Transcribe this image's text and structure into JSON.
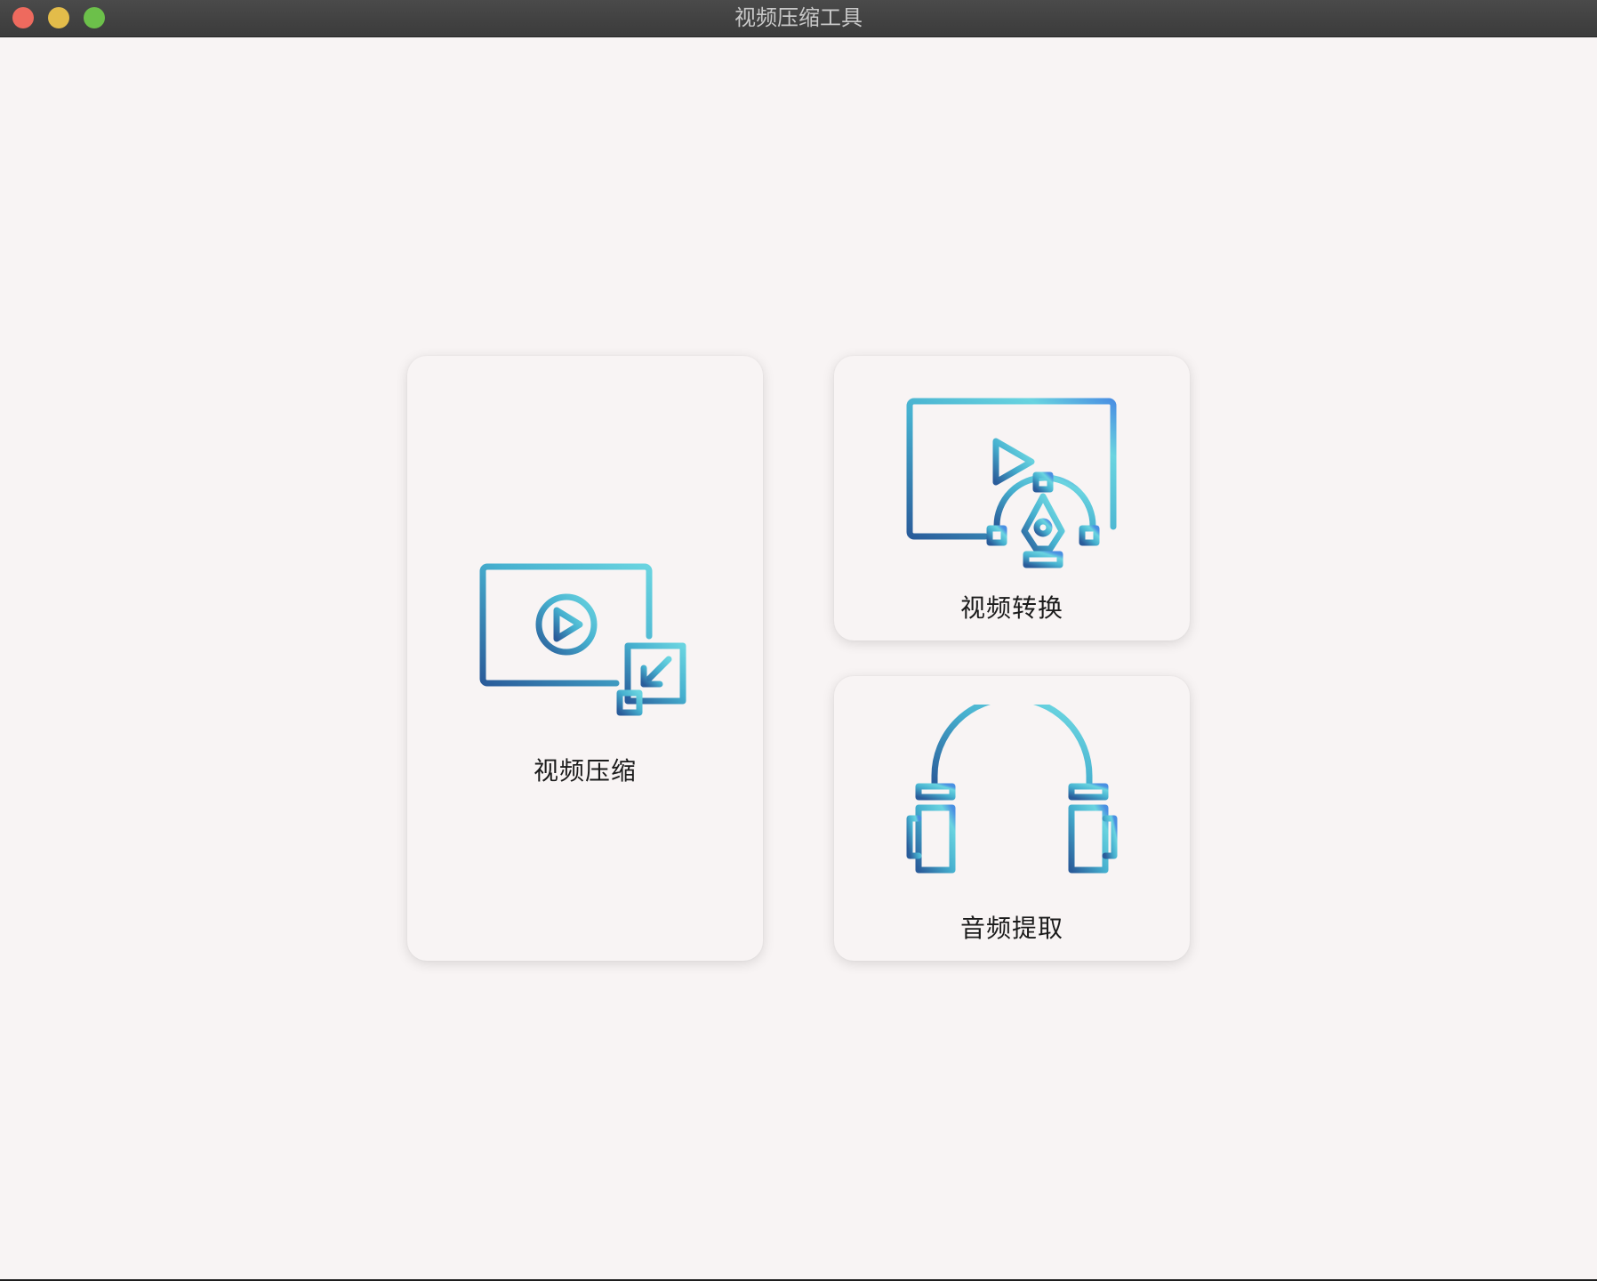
{
  "window": {
    "title": "视频压缩工具"
  },
  "traffic_lights": {
    "close_color": "#ee6a5e",
    "minimize_color": "#e3bc4a",
    "zoom_color": "#6cc04a"
  },
  "theme": {
    "background": "#f8f4f4",
    "icon_gradient_start": "#2a5c9a",
    "icon_gradient_mid": "#46b0cf",
    "icon_gradient_end": "#6ad4e0"
  },
  "cards": [
    {
      "label": "视频压缩",
      "icon": "video-compress-icon"
    },
    {
      "label": "视频转换",
      "icon": "video-convert-icon"
    },
    {
      "label": "音频提取",
      "icon": "audio-extract-icon"
    }
  ]
}
